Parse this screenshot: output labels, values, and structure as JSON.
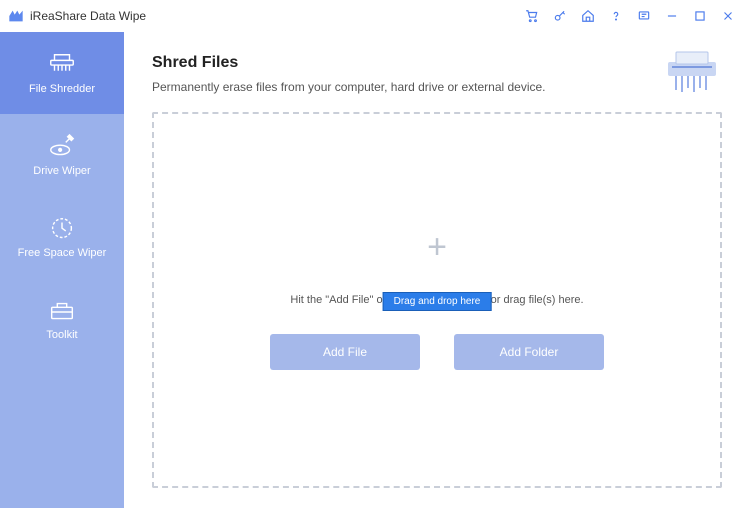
{
  "app": {
    "title": "iReaShare Data Wipe"
  },
  "sidebar": {
    "items": [
      {
        "label": "File Shredder",
        "icon": "shredder-icon"
      },
      {
        "label": "Drive Wiper",
        "icon": "drive-icon"
      },
      {
        "label": "Free Space Wiper",
        "icon": "clock-icon"
      },
      {
        "label": "Toolkit",
        "icon": "toolbox-icon"
      }
    ]
  },
  "page": {
    "heading": "Shred Files",
    "subtitle": "Permanently erase files from your computer, hard drive or external device.",
    "hint": "Hit the \"Add File\" or \"Add Folder\" button, or drag file(s) here.",
    "tooltip": "Drag and drop here",
    "add_file_label": "Add File",
    "add_folder_label": "Add Folder"
  },
  "titlebar_icons": {
    "cart": "cart-icon",
    "key": "key-icon",
    "home": "home-icon",
    "help": "help-icon",
    "feedback": "feedback-icon",
    "minimize": "minimize-icon",
    "maximize": "maximize-icon",
    "close": "close-icon"
  }
}
